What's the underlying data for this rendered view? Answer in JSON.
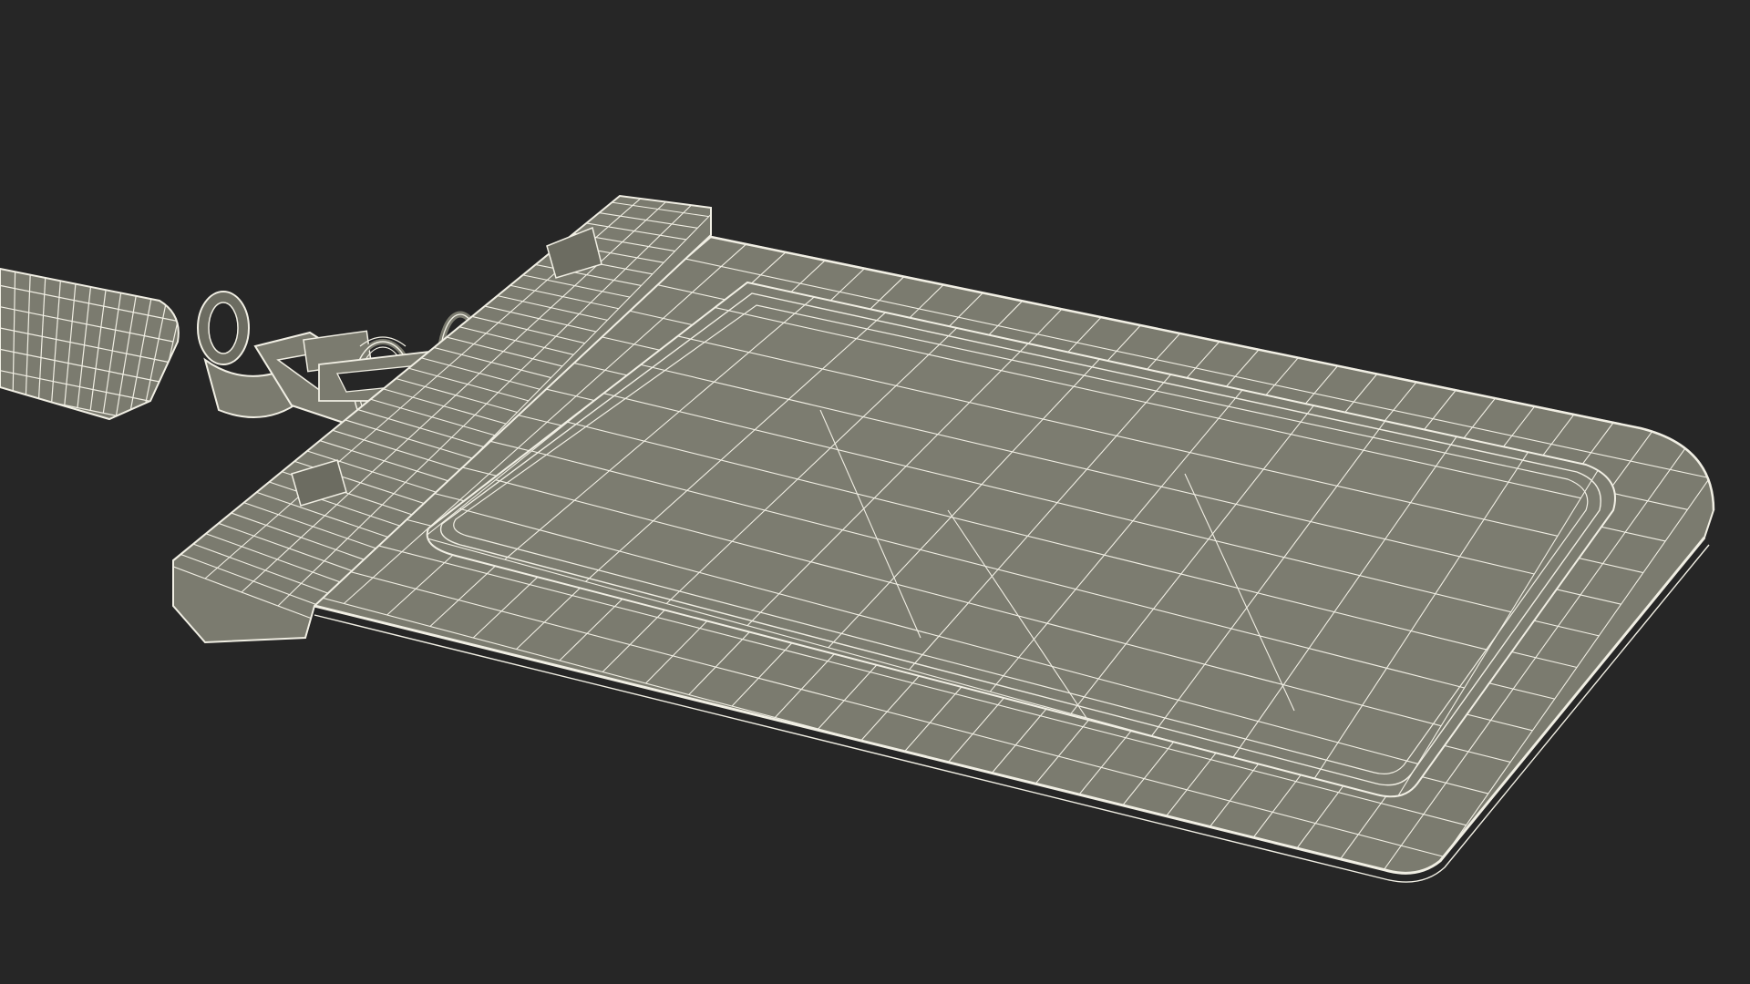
{
  "scene": {
    "subject": "badge-holder-with-lanyard-clip",
    "style": "wireframe-render",
    "colors": {
      "background": "#262626",
      "surface": "#7b7b6f",
      "surface_dark": "#6c6c61",
      "surface_light": "#8a8a7e",
      "wire": "#f1efe4",
      "wire_shadow": "#5b5b52"
    }
  }
}
